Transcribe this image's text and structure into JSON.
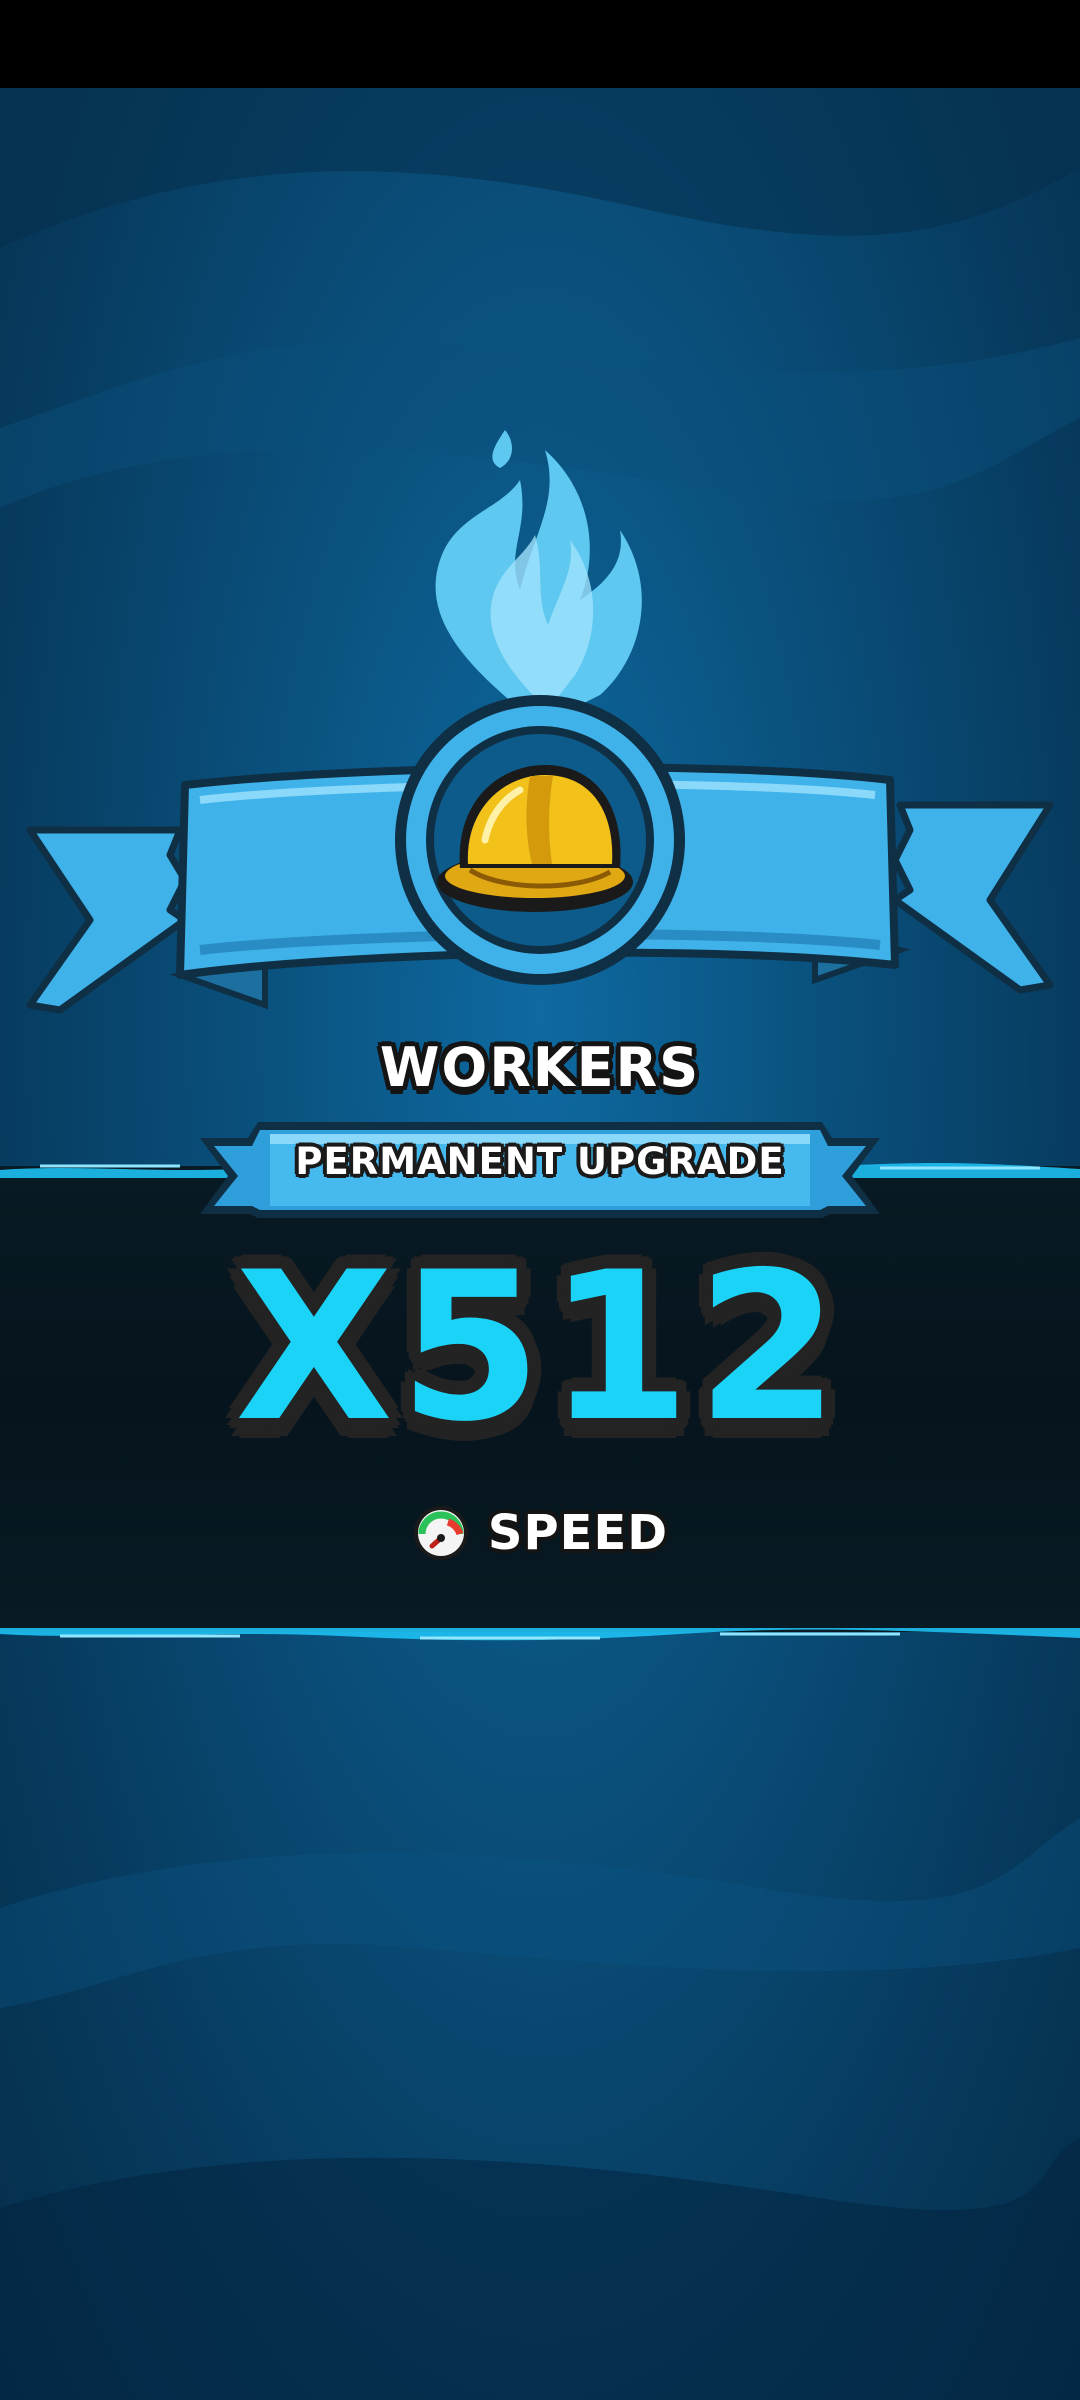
{
  "reward": {
    "title": "WORKERS",
    "banner_label": "PERMANENT UPGRADE",
    "multiplier": "X512",
    "stat_label": "SPEED",
    "item_icon": "hard-hat-icon",
    "stat_icon": "speedometer-icon"
  },
  "colors": {
    "background": "#0a527f",
    "ribbon": "#3fb2ea",
    "multiplier_text": "#1ad3f6",
    "flame": "#5ec8f0",
    "helmet": "#f2c21b"
  }
}
